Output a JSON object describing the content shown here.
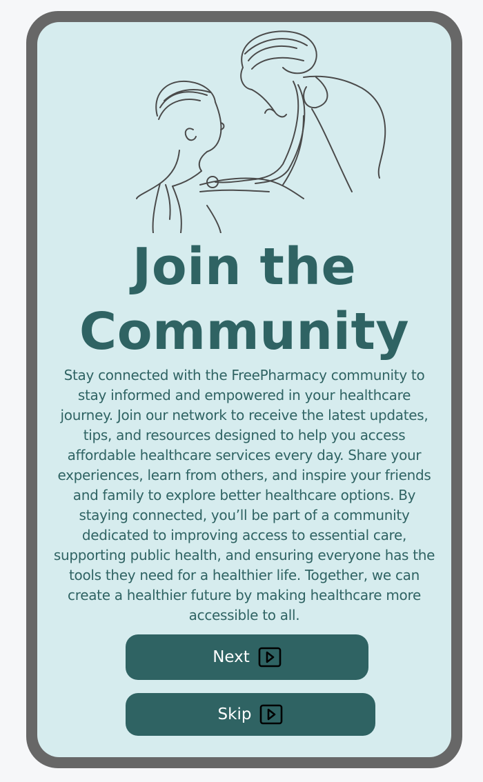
{
  "card": {
    "title_line1": "Join the",
    "title_line2": "Community",
    "description": "Stay connected with the FreePharmacy community to stay informed and empowered in your healthcare journey. Join our network to receive the latest updates, tips, and resources designed to help you access affordable healthcare services every day. Share your experiences, learn from others, and inspire your friends and family to explore better healthcare options. By staying connected, you’ll be part of a community dedicated to improving access to essential care, supporting public health, and ensuring everyone has the tools they need for a healthier life. Together, we can create a healthier future by making healthcare more accessible to all."
  },
  "buttons": {
    "next_label": "Next",
    "skip_label": "Skip"
  },
  "icons": {
    "illustration": "doctor-stethoscope-illustration",
    "button_icon": "play-icon"
  },
  "colors": {
    "primary": "#2f6363",
    "screen_bg": "#d6ecee",
    "frame": "#676767"
  }
}
